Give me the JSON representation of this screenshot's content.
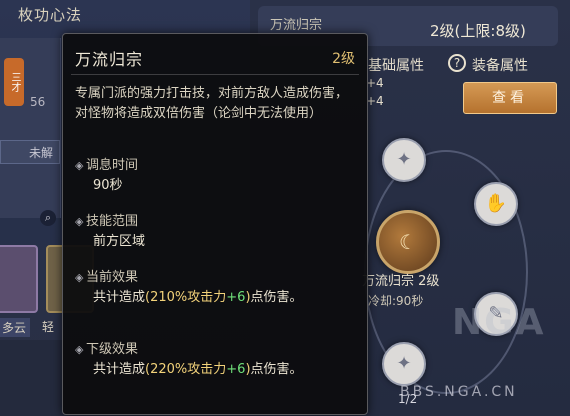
{
  "background": {
    "left_title": "枚功心法",
    "left_card_number": "56",
    "left_badge": "三才",
    "left_button": "未解",
    "slot_labels": [
      "多云",
      "轻"
    ],
    "right_header_title": "万流归宗",
    "level_text": "2级(上限:8级)",
    "attr_label": "基础属性",
    "attr_values": [
      "+4",
      "+4"
    ],
    "equip_attr_label": "装备属性",
    "view_button": "查看",
    "center_skill_name": "万流归宗 2级",
    "center_skill_cd": "冷却:90秒",
    "page_indicator": "1/2",
    "watermark": "NGA",
    "watermark_url": "BBS.NGA.CN"
  },
  "tooltip": {
    "title": "万流归宗",
    "level": "2级",
    "description": "专属门派的强力打击技，对前方敌人造成伤害，对怪物将造成双倍伤害（论剑中无法使用）",
    "sections": [
      {
        "title": "调息时间",
        "body": "90秒"
      },
      {
        "title": "技能范围",
        "body": "前方区域"
      },
      {
        "title": "当前效果",
        "body_prefix": "共计造成",
        "body_percent": "(210%攻击力",
        "body_bonus": "+6",
        "body_close": ")",
        "body_suffix": "点伤害。"
      },
      {
        "title": "下级效果",
        "body_prefix": "共计造成",
        "body_percent": "(220%攻击力",
        "body_bonus": "+6",
        "body_close": ")",
        "body_suffix": "点伤害。"
      }
    ]
  },
  "icons": {
    "section_bullet": "diamond-bullet-icon",
    "help": "question-circle-icon",
    "search": "magnifier-icon"
  },
  "colors": {
    "tooltip_bg": "#0c0c0e",
    "highlight_yellow": "#f2d27a",
    "highlight_green": "#6fe07a",
    "level_gold": "#e0bf72",
    "button_orange": "#c98540"
  }
}
